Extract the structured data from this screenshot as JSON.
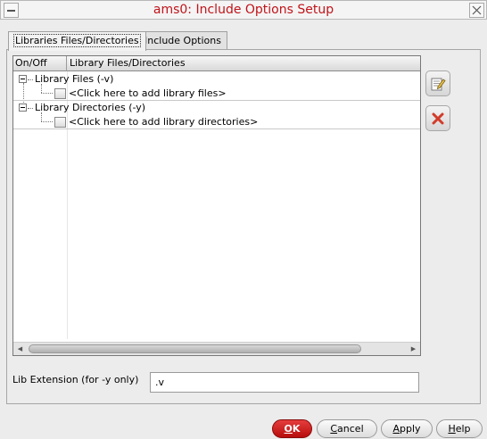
{
  "window": {
    "title": "ams0: Include Options Setup"
  },
  "tabs": [
    {
      "label": "Libraries Files/Directories",
      "active": true
    },
    {
      "label": "Include Options",
      "active": false
    }
  ],
  "tree": {
    "columns": [
      "On/Off",
      "Library Files/Directories"
    ],
    "groups": [
      {
        "label": "Library Files (-v)",
        "child": "<Click here to add library files>"
      },
      {
        "label": "Library Directories (-y)",
        "child": "<Click here to add library directories>"
      }
    ]
  },
  "side_buttons": {
    "edit_icon": "edit-icon",
    "delete_icon": "delete-x-icon"
  },
  "lib_extension": {
    "label": "Lib Extension (for -y only)",
    "value": ".v"
  },
  "buttons": {
    "ok": {
      "prefix": "",
      "underline": "O",
      "suffix": "K"
    },
    "cancel": {
      "prefix": "",
      "underline": "C",
      "suffix": "ancel"
    },
    "apply": {
      "prefix": "",
      "underline": "A",
      "suffix": "pply"
    },
    "help": {
      "prefix": "",
      "underline": "H",
      "suffix": "elp"
    }
  },
  "colors": {
    "title": "#c0141a",
    "ok_button": "#c41717"
  }
}
